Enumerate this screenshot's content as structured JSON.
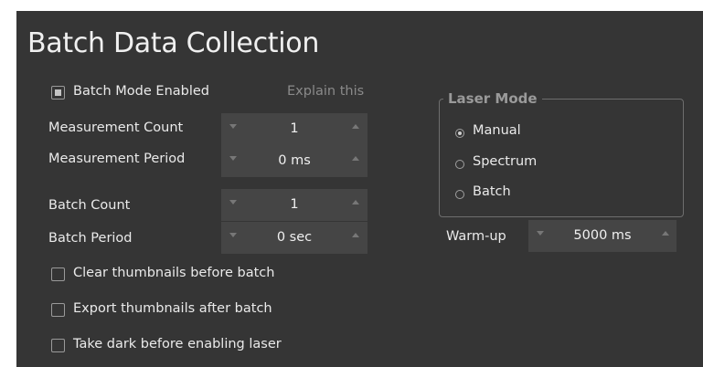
{
  "title": "Batch Data Collection",
  "batch_mode": {
    "label": "Batch Mode Enabled",
    "checked": true,
    "explain": "Explain this"
  },
  "measurement_count": {
    "label": "Measurement Count",
    "value": "1"
  },
  "measurement_period": {
    "label": "Measurement Period",
    "value": "0 ms"
  },
  "batch_count": {
    "label": "Batch Count",
    "value": "1"
  },
  "batch_period": {
    "label": "Batch Period",
    "value": "0 sec"
  },
  "options": [
    {
      "label": "Clear thumbnails before batch",
      "checked": false
    },
    {
      "label": "Export thumbnails after batch",
      "checked": false
    },
    {
      "label": "Take dark before enabling laser",
      "checked": false
    }
  ],
  "laser_mode": {
    "title": "Laser Mode",
    "options": [
      {
        "label": "Manual",
        "selected": true
      },
      {
        "label": "Spectrum",
        "selected": false
      },
      {
        "label": "Batch",
        "selected": false
      }
    ]
  },
  "warmup": {
    "label": "Warm-up",
    "value": "5000 ms"
  },
  "colors": {
    "panel": "#353535",
    "spinbox": "#454545",
    "text": "#eaeaea",
    "muted": "#8a8a8a"
  }
}
